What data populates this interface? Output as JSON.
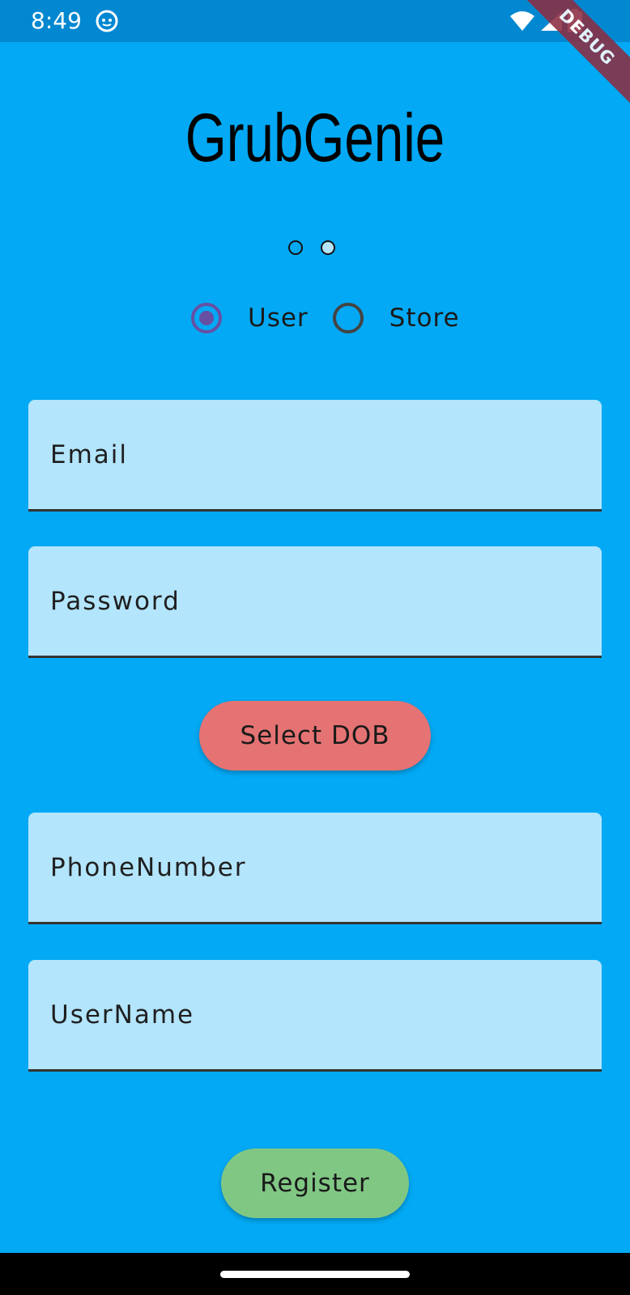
{
  "status_bar": {
    "time": "8:49",
    "app_icon": "android-robot-icon",
    "icons": [
      "wifi-icon",
      "signal-icon",
      "battery-icon"
    ]
  },
  "debug_banner": "DEBUG",
  "app": {
    "title": "GrubGenie"
  },
  "pager": {
    "page_count": 2,
    "active_index": 0
  },
  "account_type": {
    "options": [
      {
        "label": "User",
        "checked": true
      },
      {
        "label": "Store",
        "checked": false
      }
    ]
  },
  "form": {
    "email_placeholder": "Email",
    "password_placeholder": "Password",
    "dob_button_label": "Select DOB",
    "phone_placeholder": "PhoneNumber",
    "username_placeholder": "UserName",
    "register_button_label": "Register"
  },
  "colors": {
    "background": "#03a9f4",
    "field_fill": "#b3e5fc",
    "dob_button": "#e57373",
    "register_button": "#81c784",
    "radio_checked": "#6750a4",
    "debug_banner": "#8b2d42"
  }
}
